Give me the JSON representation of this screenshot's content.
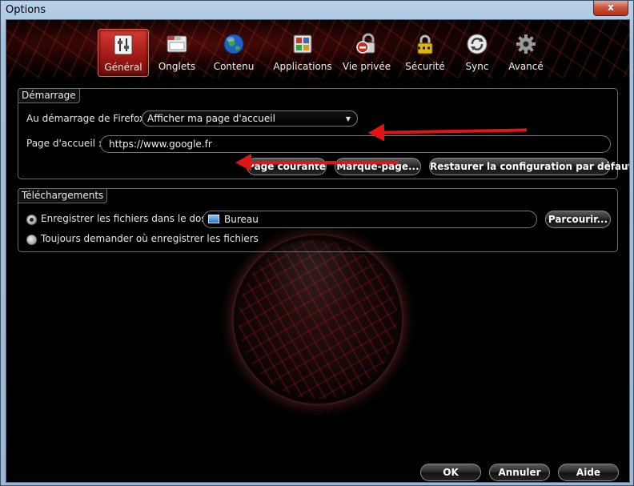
{
  "window": {
    "title": "Options",
    "close_glyph": "x"
  },
  "tabs": [
    {
      "label": "Général",
      "icon": "general-icon",
      "active": true
    },
    {
      "label": "Onglets",
      "icon": "tabs-icon"
    },
    {
      "label": "Contenu",
      "icon": "globe-icon"
    },
    {
      "label": "Applications",
      "icon": "applications-icon"
    },
    {
      "label": "Vie privée",
      "icon": "privacy-icon"
    },
    {
      "label": "Sécurité",
      "icon": "lock-icon"
    },
    {
      "label": "Sync",
      "icon": "sync-icon"
    },
    {
      "label": "Avancé",
      "icon": "gear-icon"
    }
  ],
  "startup": {
    "legend": "Démarrage",
    "on_start_label": "Au démarrage de Firefox :",
    "on_start_value": "Afficher ma page d'accueil",
    "homepage_label": "Page d'accueil :",
    "homepage_value": "https://www.google.fr",
    "btn_current": "Page courante",
    "btn_bookmark": "Marque-page...",
    "btn_restore": "Restaurer la configuration par défaut"
  },
  "downloads": {
    "legend": "Téléchargements",
    "save_label": "Enregistrer les fichiers dans le dossier",
    "folder_value": "Bureau",
    "browse_button": "Parcourir...",
    "ask_label": "Toujours demander où enregistrer les fichiers",
    "selected": "save"
  },
  "footer": {
    "ok": "OK",
    "cancel": "Annuler",
    "help": "Aide"
  },
  "colors": {
    "accent_red": "#e21414",
    "active_tab": "#c42a22"
  }
}
